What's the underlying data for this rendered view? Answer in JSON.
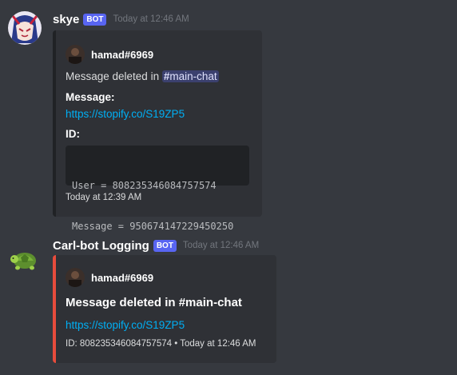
{
  "messages": [
    {
      "username": "skye",
      "bot_tag": "BOT",
      "timestamp": "Today at 12:46 AM",
      "embed": {
        "author": "hamad#6969",
        "description_prefix": "Message deleted in ",
        "channel_mention": "main-chat",
        "message_label": "Message:",
        "message_link": "https://stopify.co/S19ZP5",
        "id_label": "ID:",
        "code_line1": "User = 808235346084757574",
        "code_line2": "Message = 950674147229450250",
        "footer": "Today at 12:39 AM",
        "bar_color": "#202225"
      }
    },
    {
      "username": "Carl-bot Logging",
      "bot_tag": "BOT",
      "timestamp": "Today at 12:46 AM",
      "embed": {
        "author": "hamad#6969",
        "title": "Message deleted in #main-chat",
        "link": "https://stopify.co/S19ZP5",
        "footer_id": "ID: 808235346084757574",
        "footer_sep": "•",
        "footer_time": "Today at 12:46 AM",
        "bar_color": "#e74c3c"
      }
    }
  ],
  "colors": {
    "background": "#36393f",
    "embed": "#2f3136",
    "bot_tag": "#5865f2",
    "link": "#00aff4"
  }
}
